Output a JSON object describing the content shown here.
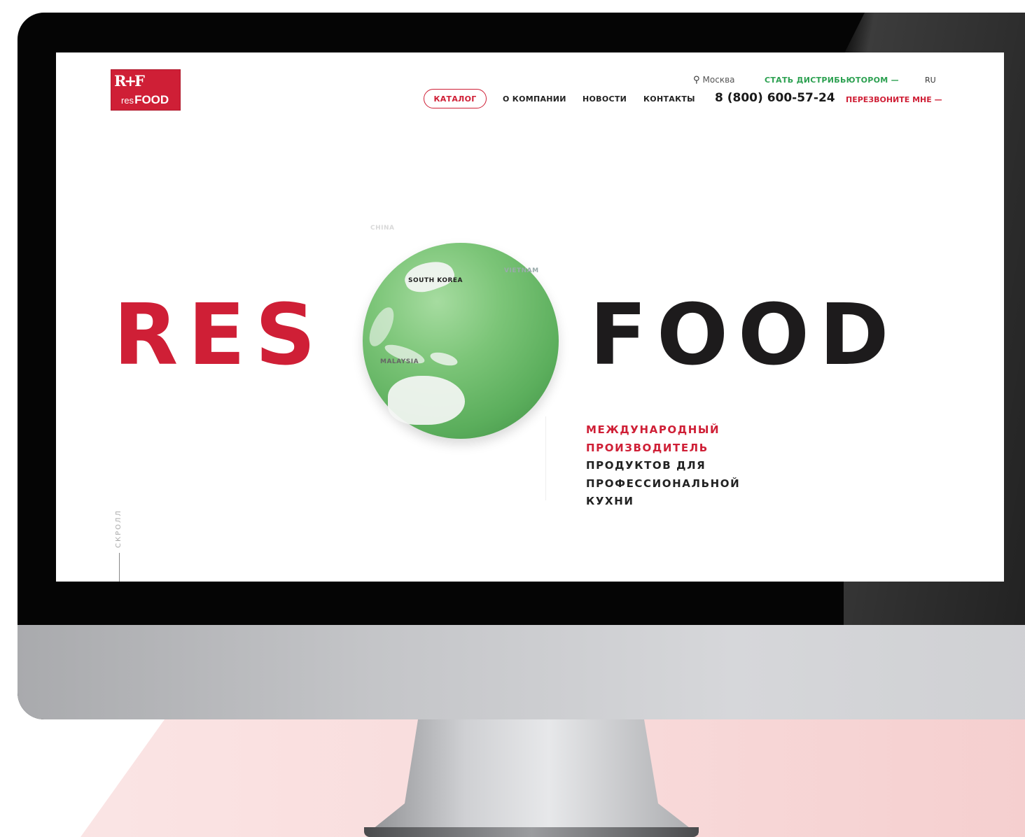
{
  "header": {
    "logo": {
      "mark": "R+F",
      "prefix": "res",
      "word": "FOOD"
    },
    "city": "Москва",
    "become_distributor": "СТАТЬ ДИСТРИБЬЮТОРОМ —",
    "language": "RU",
    "nav": {
      "catalog": "КАТАЛОГ",
      "about": "О КОМПАНИИ",
      "news": "НОВОСТИ",
      "contacts": "КОНТАКТЫ"
    },
    "phone": "8 (800) 600-57-24",
    "callback": "ПЕРЕЗВОНИТЕ МНЕ —"
  },
  "hero": {
    "title_left": "RES",
    "title_right": "FOOD",
    "globe_labels": {
      "china": "CHINA",
      "korea": "SOUTH KOREA",
      "vietnam": "VIETNAM",
      "malaysia": "MALAYSIA"
    },
    "tagline": {
      "line1": "МЕЖДУНАРОДНЫЙ",
      "line2": "ПРОИЗВОДИТЕЛЬ",
      "line3": "ПРОДУКТОВ ДЛЯ",
      "line4": "ПРОФЕССИОНАЛЬНОЙ",
      "line5": "КУХНИ"
    }
  },
  "scroll": {
    "label": "СКРОЛЛ"
  },
  "icons": {
    "location": "map-pin-icon"
  },
  "colors": {
    "accent": "#cf1f36",
    "green": "#2ba050",
    "dark": "#1d1b1c"
  }
}
